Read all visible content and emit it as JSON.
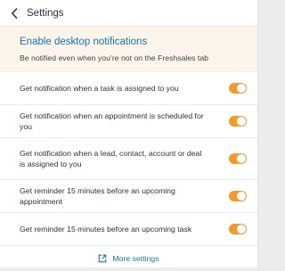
{
  "header": {
    "back_icon": "chevron-left-icon",
    "title": "Settings"
  },
  "banner": {
    "title": "Enable desktop notifications",
    "subtitle": "Be notified even when you’re not on the Freshsales tab",
    "background": "#fdf5e9",
    "title_color": "#1d6fb8"
  },
  "settings": [
    {
      "label": "Get notification when a task is assigned to you",
      "enabled": true
    },
    {
      "label": "Get notification when an appointment is scheduled for you",
      "enabled": true
    },
    {
      "label": "Get notification when a lead, contact, account or deal is assigned to you",
      "enabled": true
    },
    {
      "label": "Get reminder 15 minutes before an upcoming appointment",
      "enabled": true
    },
    {
      "label": "Get reminder 15 minutes before an upcoming task",
      "enabled": true
    }
  ],
  "toggle_color": "#f19a2e",
  "footer": {
    "icon": "external-link-icon",
    "link_label": "More settings",
    "link_color": "#1d6fb8"
  }
}
